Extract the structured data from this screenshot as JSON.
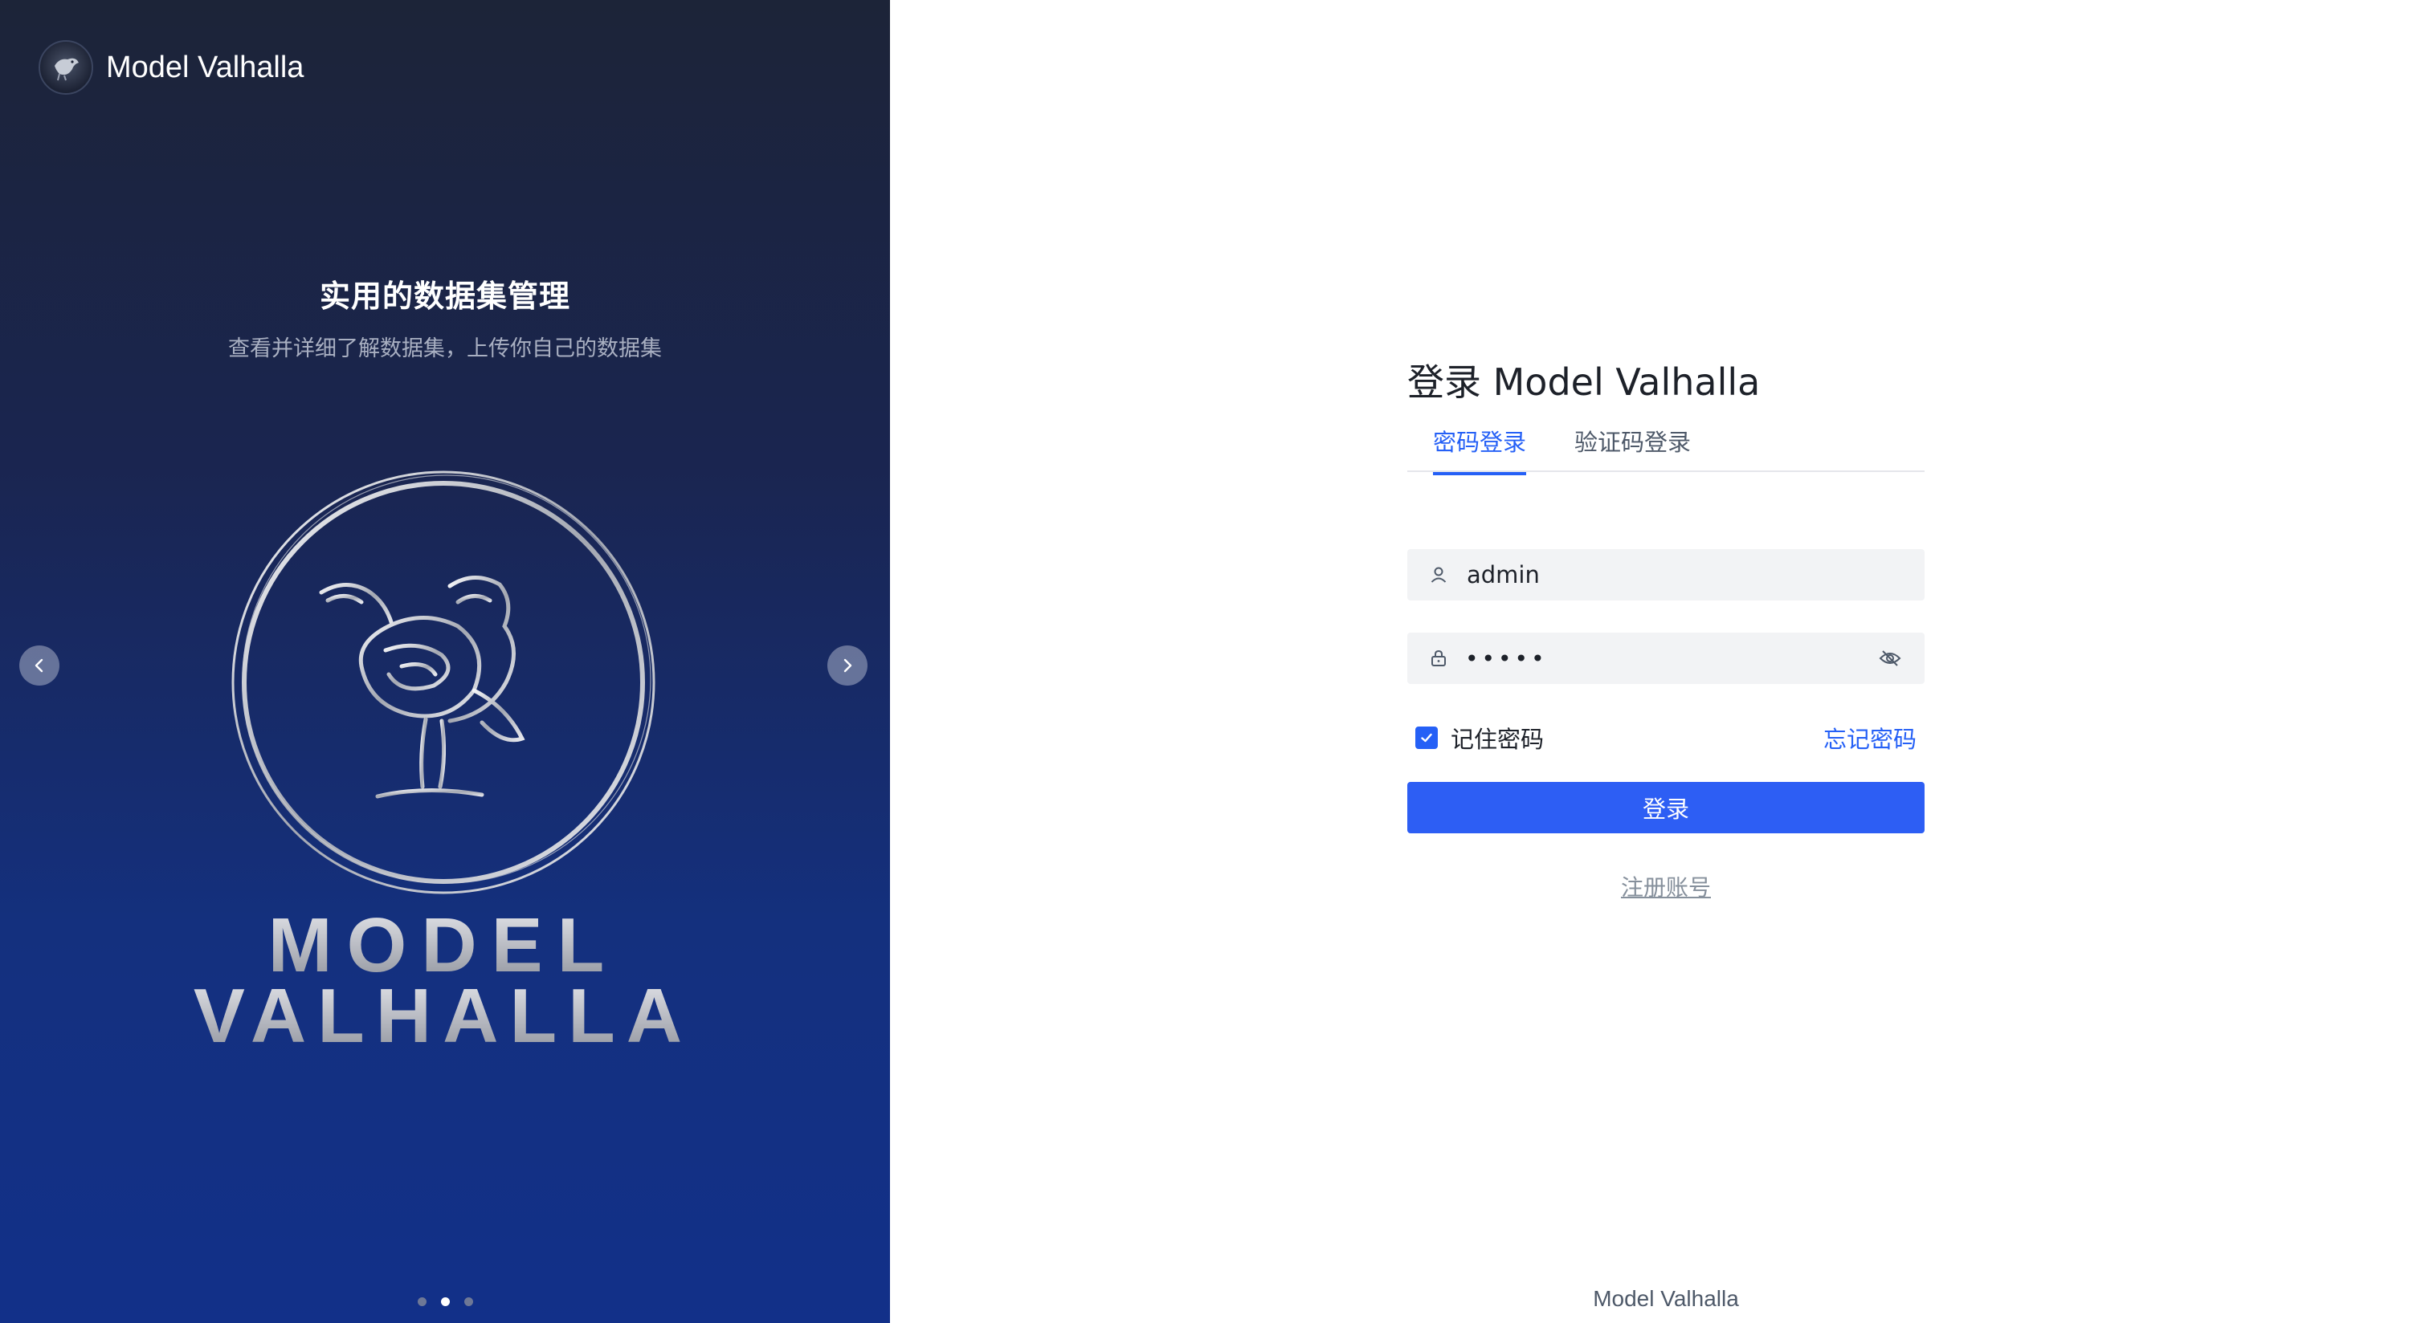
{
  "brand": {
    "name": "Model Valhalla"
  },
  "carousel": {
    "title": "实用的数据集管理",
    "subtitle": "查看并详细了解数据集，上传你自己的数据集",
    "hero_text_line1": "MODEL",
    "hero_text_line2": "VALHALLA",
    "slide_count": 3,
    "active_index": 1
  },
  "login": {
    "title": "登录 Model Valhalla",
    "tabs": [
      {
        "label": "密码登录",
        "active": true
      },
      {
        "label": "验证码登录",
        "active": false
      }
    ],
    "username": {
      "value": "admin",
      "icon": "user-icon"
    },
    "password": {
      "value": "•••••",
      "icon": "lock-icon",
      "toggle_icon": "eye-off-icon"
    },
    "remember": {
      "label": "记住密码",
      "checked": true
    },
    "forgot_label": "忘记密码",
    "submit_label": "登录",
    "register_label": "注册账号"
  },
  "footer": {
    "text": "Model Valhalla"
  },
  "colors": {
    "accent": "#2560f6",
    "panel_top": "#1c2438",
    "panel_bottom": "#123089"
  }
}
